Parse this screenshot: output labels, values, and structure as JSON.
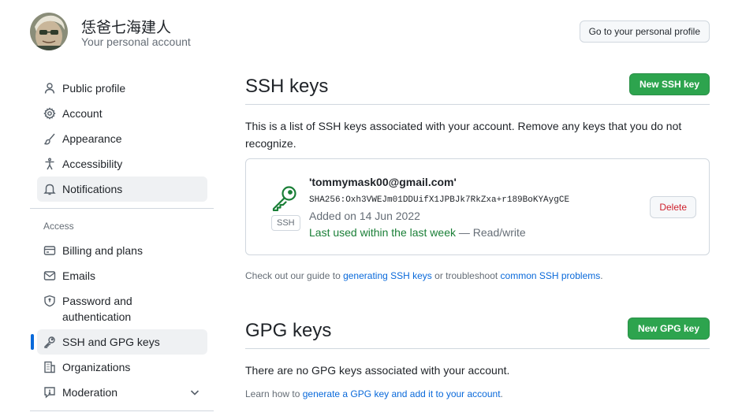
{
  "header": {
    "user_name": "恁爸七海建人",
    "account_type": "Your personal account",
    "profile_button": "Go to your personal profile"
  },
  "sidebar": {
    "items": [
      {
        "label": "Public profile",
        "icon": "person-icon"
      },
      {
        "label": "Account",
        "icon": "gear-icon"
      },
      {
        "label": "Appearance",
        "icon": "paintbrush-icon"
      },
      {
        "label": "Accessibility",
        "icon": "accessibility-icon"
      },
      {
        "label": "Notifications",
        "icon": "bell-icon"
      }
    ],
    "access_heading": "Access",
    "access_items": [
      {
        "label": "Billing and plans",
        "icon": "credit-card-icon"
      },
      {
        "label": "Emails",
        "icon": "mail-icon"
      },
      {
        "label": "Password and authentication",
        "label_line1": "Password and",
        "label_line2": "authentication",
        "icon": "shield-lock-icon"
      },
      {
        "label": "SSH and GPG keys",
        "icon": "key-icon",
        "active": true
      },
      {
        "label": "Organizations",
        "icon": "organization-icon"
      },
      {
        "label": "Moderation",
        "icon": "report-icon",
        "expandable": true
      }
    ]
  },
  "ssh": {
    "title": "SSH keys",
    "new_button": "New SSH key",
    "description": "This is a list of SSH keys associated with your account. Remove any keys that you do not recognize.",
    "key": {
      "type_label": "SSH",
      "title": "'tommymask00@gmail.com'",
      "fingerprint": "SHA256:Oxh3VWEJm01DDUifX1JPBJk7RkZxa+r189BoKYAygCE",
      "added": "Added on 14 Jun 2022",
      "last_used": "Last used within the last week",
      "access": " — Read/write",
      "delete_button": "Delete"
    },
    "footer_prefix": "Check out our guide to ",
    "footer_link1": "generating SSH keys",
    "footer_middle": " or troubleshoot ",
    "footer_link2": "common SSH problems",
    "footer_suffix": "."
  },
  "gpg": {
    "title": "GPG keys",
    "new_button": "New GPG key",
    "empty_text": "There are no GPG keys associated with your account.",
    "footer_prefix": "Learn how to ",
    "footer_link": "generate a GPG key and add it to your account",
    "footer_suffix": "."
  },
  "colors": {
    "accent": "#0969da",
    "primary_button": "#2da44e",
    "success_text": "#1a7f37",
    "danger_text": "#cf222e"
  }
}
